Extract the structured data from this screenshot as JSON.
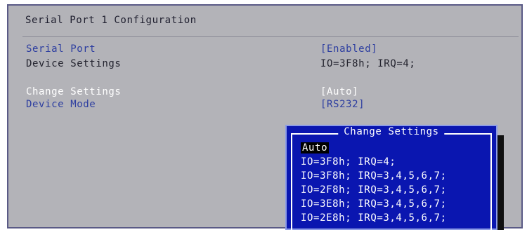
{
  "header": {
    "title": "Serial Port 1 Configuration"
  },
  "settings": {
    "serial_port": {
      "label": "Serial Port",
      "value": "[Enabled]"
    },
    "device_settings": {
      "label": "Device Settings",
      "value": "IO=3F8h; IRQ=4;"
    },
    "change_settings": {
      "label": "Change Settings",
      "value": "[Auto]"
    },
    "device_mode": {
      "label": "Device Mode",
      "value": "[RS232]"
    }
  },
  "popup": {
    "title": "Change Settings",
    "options": [
      "Auto",
      "IO=3F8h; IRQ=4;",
      "IO=3F8h; IRQ=3,4,5,6,7;",
      "IO=2F8h; IRQ=3,4,5,6,7;",
      "IO=3E8h; IRQ=3,4,5,6,7;",
      "IO=2E8h; IRQ=3,4,5,6,7;"
    ],
    "selected_index": 0
  },
  "colors": {
    "bios_background": "#b3b3b8",
    "popup_background": "#0a16b0",
    "selectable_label": "#2d3ea0",
    "highlight": "#ffffff"
  }
}
